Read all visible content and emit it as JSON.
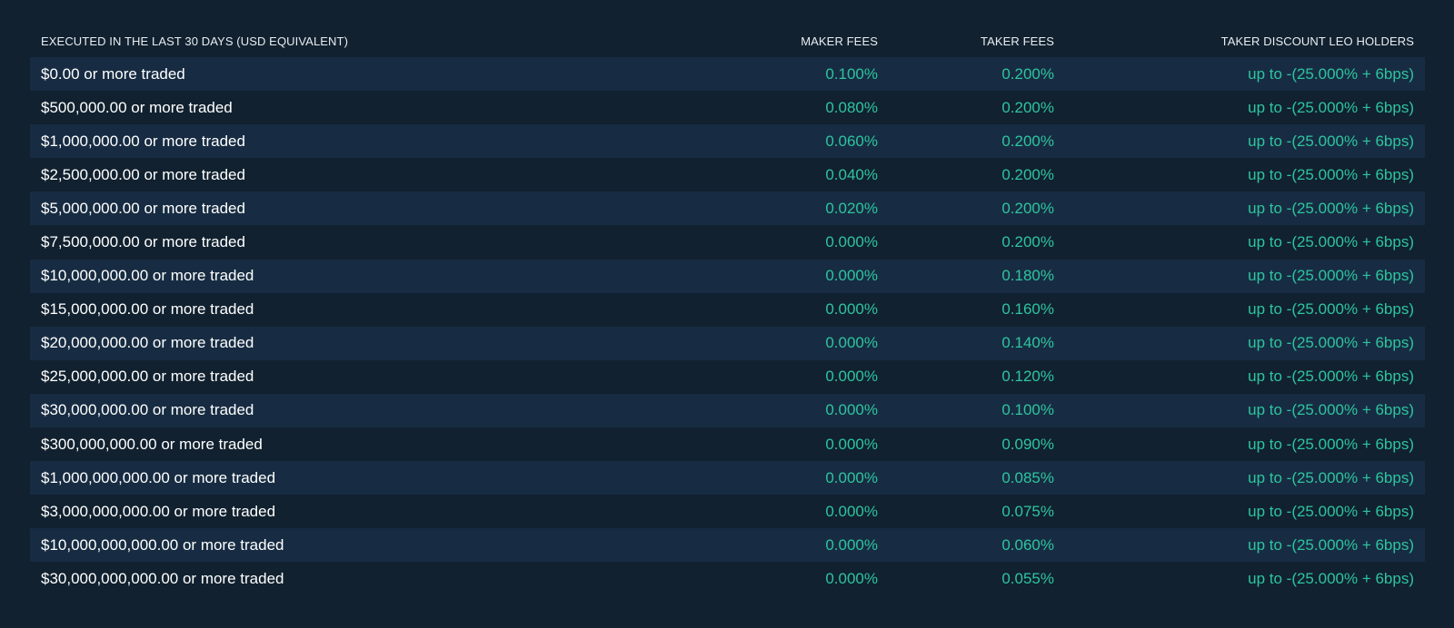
{
  "table": {
    "headers": {
      "volume": "EXECUTED IN THE LAST 30 DAYS (USD EQUIVALENT)",
      "maker": "MAKER FEES",
      "taker": "TAKER FEES",
      "discount": "TAKER DISCOUNT LEO HOLDERS"
    },
    "rows": [
      {
        "volume": "$0.00 or more traded",
        "maker": "0.100%",
        "taker": "0.200%",
        "discount": "up to -(25.000% + 6bps)"
      },
      {
        "volume": "$500,000.00 or more traded",
        "maker": "0.080%",
        "taker": "0.200%",
        "discount": "up to -(25.000% + 6bps)"
      },
      {
        "volume": "$1,000,000.00 or more traded",
        "maker": "0.060%",
        "taker": "0.200%",
        "discount": "up to -(25.000% + 6bps)"
      },
      {
        "volume": "$2,500,000.00 or more traded",
        "maker": "0.040%",
        "taker": "0.200%",
        "discount": "up to -(25.000% + 6bps)"
      },
      {
        "volume": "$5,000,000.00 or more traded",
        "maker": "0.020%",
        "taker": "0.200%",
        "discount": "up to -(25.000% + 6bps)"
      },
      {
        "volume": "$7,500,000.00 or more traded",
        "maker": "0.000%",
        "taker": "0.200%",
        "discount": "up to -(25.000% + 6bps)"
      },
      {
        "volume": "$10,000,000.00 or more traded",
        "maker": "0.000%",
        "taker": "0.180%",
        "discount": "up to -(25.000% + 6bps)"
      },
      {
        "volume": "$15,000,000.00 or more traded",
        "maker": "0.000%",
        "taker": "0.160%",
        "discount": "up to -(25.000% + 6bps)"
      },
      {
        "volume": "$20,000,000.00 or more traded",
        "maker": "0.000%",
        "taker": "0.140%",
        "discount": "up to -(25.000% + 6bps)"
      },
      {
        "volume": "$25,000,000.00 or more traded",
        "maker": "0.000%",
        "taker": "0.120%",
        "discount": "up to -(25.000% + 6bps)"
      },
      {
        "volume": "$30,000,000.00 or more traded",
        "maker": "0.000%",
        "taker": "0.100%",
        "discount": "up to -(25.000% + 6bps)"
      },
      {
        "volume": "$300,000,000.00 or more traded",
        "maker": "0.000%",
        "taker": "0.090%",
        "discount": "up to -(25.000% + 6bps)"
      },
      {
        "volume": "$1,000,000,000.00 or more traded",
        "maker": "0.000%",
        "taker": "0.085%",
        "discount": "up to -(25.000% + 6bps)"
      },
      {
        "volume": "$3,000,000,000.00 or more traded",
        "maker": "0.000%",
        "taker": "0.075%",
        "discount": "up to -(25.000% + 6bps)"
      },
      {
        "volume": "$10,000,000,000.00 or more traded",
        "maker": "0.000%",
        "taker": "0.060%",
        "discount": "up to -(25.000% + 6bps)"
      },
      {
        "volume": "$30,000,000,000.00 or more traded",
        "maker": "0.000%",
        "taker": "0.055%",
        "discount": "up to -(25.000% + 6bps)"
      }
    ]
  },
  "colors": {
    "background": "#11212f",
    "row_alt": "#172c42",
    "accent_green": "#2ec4a0",
    "text": "#ffffff"
  }
}
